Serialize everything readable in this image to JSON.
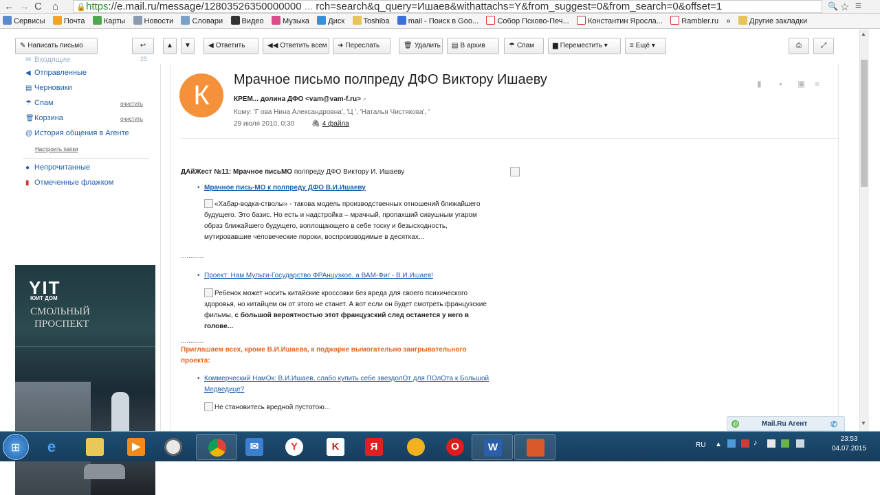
{
  "browser": {
    "url_https": "https",
    "url_rest": "://e.mail.ru/message/12803526350000000",
    "url_tail": "rch=search&q_query=Ишаев&withattachs=Y&from_suggest=0&from_search=0&offset=1"
  },
  "bookmarks": [
    {
      "label": "Сервисы"
    },
    {
      "label": "Почта"
    },
    {
      "label": "Карты"
    },
    {
      "label": "Новости"
    },
    {
      "label": "Словари"
    },
    {
      "label": "Видео"
    },
    {
      "label": "Музыка"
    },
    {
      "label": "Диск"
    },
    {
      "label": "Toshiba"
    },
    {
      "label": "mail - Поиск в Goo..."
    },
    {
      "label": "Собор Псково-Печ..."
    },
    {
      "label": "Константин Яросла..."
    },
    {
      "label": "Rambler.ru"
    },
    {
      "label": "»"
    },
    {
      "label": "Другие закладки"
    }
  ],
  "toolbar": {
    "compose": "Написать письмо",
    "reply": "Ответить",
    "reply_all": "Ответить всем",
    "forward": "Переслать",
    "delete": "Удалить",
    "archive": "В архив",
    "spam": "Спам",
    "move": "Переместить ▾",
    "more": "≡ Ещё ▾"
  },
  "sidebar": {
    "inbox": "Входящие",
    "inbox_count": "25",
    "sent": "Отправленные",
    "drafts": "Черновики",
    "spam": "Спам",
    "trash": "Корзина",
    "clear": "очистить",
    "agent_history": "История общения в Агенте",
    "setup_folders": "Настроить папки",
    "unread": "Непрочитанные",
    "flagged": "Отмеченные флажком"
  },
  "ad": {
    "brand": "YIT",
    "brand_sub": "ЮИТ ДОМ",
    "line1": "СМОЛЬНЫЙ",
    "line2": "ПРОСПЕКТ"
  },
  "message": {
    "avatar_letter": "К",
    "subject": "Мрачное письмо полпреду ДФО Виктору Ишаеву",
    "from": "КРЕМ... долина ДФО <vam@vam-f.ru>",
    "to": "Кому: 'Г      ова Нина Александровна', 'Ц     ', 'Наталья Чистякова', '",
    "date": "29 июля 2010, 0:30",
    "files": "4 файла",
    "digest_label": "ДАйЖест №11: ",
    "digest_bold": "Мрачное письМО",
    "digest_rest": " полпреду ДФО Виктору И. Ишаеву",
    "item1_link": "Мрачное пись-МО к полпреду ДФО В.И.Ишаеву",
    "item1_text": "«Хабар-водка-стволы» - такова модель производственных отношений ближайшего будущего. Это базис. Но есть и надстройка – мрачный, пропахший сивушным угаром образ ближайшего будущего, воплощающего в себе тоску и безысходность, мутировавшие человеческие пороки, воспроизводимые в десятках...",
    "dots": "............",
    "item2_link": "Проект: Нам Мульти-Государство ФРАнцузкое, а ВАМ-Фиг - В.И.Ишаев!",
    "item2_text": "Ребенок может носить китайские кроссовки без вреда для своего психического здоровья, но китайцем он от этого не станет. А вот если он будет смотреть французские фильмы, ",
    "item2_bold": "с большой вероятностью этот французский след останется у него в голове...",
    "invite": "Приглашаем всех, кроме В.И.Ишаева, к поджарке вымогательно заигрывательного проекта:",
    "item3_link": "Коммерческий НамОк: В.И.Ишаев, слабо купить себе звездолОт для ПОлОта к Большой Медведице?",
    "item4_cut": "Не становитесь вредной пустотою..."
  },
  "agent": {
    "label": "Mail.Ru Агент"
  },
  "taskbar": {
    "lang": "RU",
    "time": "23:53",
    "date": "04.07.2015"
  }
}
